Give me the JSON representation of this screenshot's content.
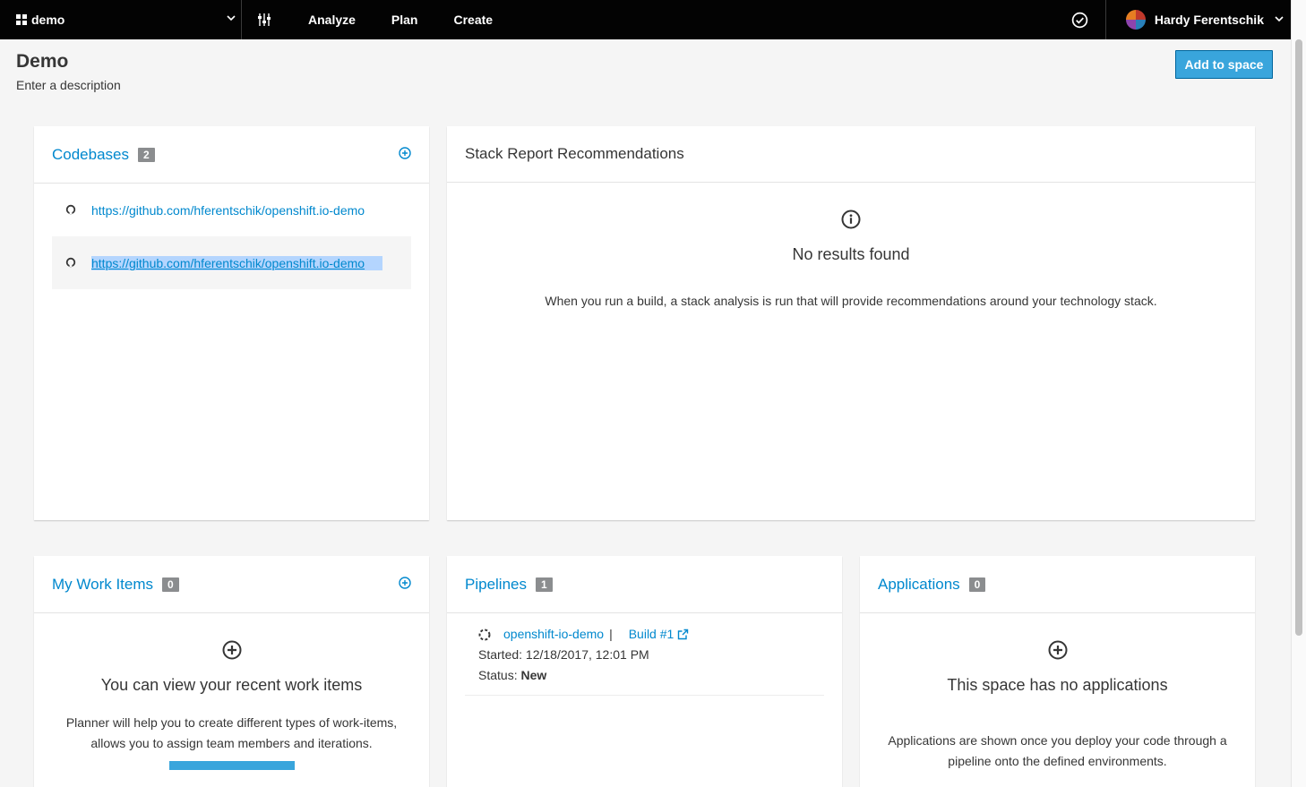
{
  "nav": {
    "space_name": "demo",
    "links": [
      "Analyze",
      "Plan",
      "Create"
    ],
    "user_name": "Hardy Ferentschik"
  },
  "header": {
    "title": "Demo",
    "description": "Enter a description",
    "add_button": "Add to space"
  },
  "codebases": {
    "title": "Codebases",
    "count": "2",
    "repos": [
      "https://github.com/hferentschik/openshift.io-demo",
      "https://github.com/hferentschik/openshift.io-demo"
    ]
  },
  "stack_report": {
    "title": "Stack Report Recommendations",
    "empty_title": "No results found",
    "empty_text": "When you run a build, a stack analysis is run that will provide recommendations around your technology stack."
  },
  "work_items": {
    "title": "My Work Items",
    "count": "0",
    "empty_title": "You can view your recent work items",
    "empty_text_1": "Planner will help you to create different types of work-items,",
    "empty_text_2": "allows you to assign team members and iterations."
  },
  "pipelines": {
    "title": "Pipelines",
    "count": "1",
    "name": "openshift-io-demo",
    "separator": "|",
    "build": "Build #1",
    "started": "Started: 12/18/2017, 12:01 PM",
    "status_label": "Status:",
    "status_value": "New"
  },
  "applications": {
    "title": "Applications",
    "count": "0",
    "empty_title": "This space has no applications",
    "empty_text_1": "Applications are shown once you deploy your code through a",
    "empty_text_2": "pipeline onto the defined environments."
  },
  "colors": {
    "navbar": "#030303",
    "link": "#0088ce",
    "button": "#39a5dc",
    "badge": "#8b8d8f",
    "background": "#f5f5f5"
  }
}
